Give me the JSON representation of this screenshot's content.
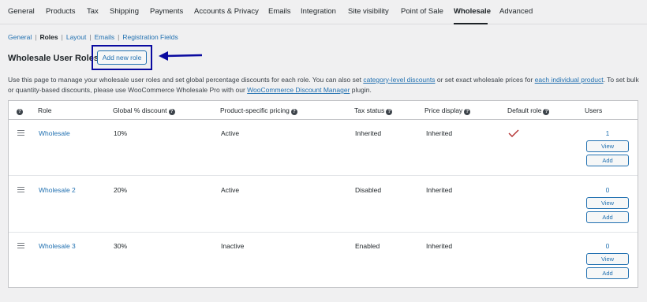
{
  "tabs": [
    {
      "label": "General"
    },
    {
      "label": "Products"
    },
    {
      "label": "Tax"
    },
    {
      "label": "Shipping"
    },
    {
      "label": "Payments"
    },
    {
      "label": "Accounts & Privacy"
    },
    {
      "label": "Emails"
    },
    {
      "label": "Integration"
    },
    {
      "label": "Site visibility"
    },
    {
      "label": "Point of Sale"
    },
    {
      "label": "Wholesale"
    },
    {
      "label": "Advanced"
    }
  ],
  "subnav": {
    "items": [
      "General",
      "Roles",
      "Layout",
      "Emails",
      "Registration Fields"
    ],
    "separator": "|"
  },
  "page": {
    "title": "Wholesale User Roles",
    "add_button": "Add new role"
  },
  "description": {
    "part1": "Use this page to manage your wholesale user roles and set global percentage discounts for each role. You can also set ",
    "link1": "category-level discounts",
    "part2": " or set exact wholesale prices for ",
    "link2": "each individual product",
    "part3": ". To set bulk or quantity-based discounts, please use WooCommerce Wholesale Pro with our ",
    "link3": "WooCommerce Discount Manager",
    "part4": " plugin."
  },
  "table": {
    "headers": {
      "role": "Role",
      "discount": "Global % discount",
      "pricing": "Product-specific pricing",
      "tax": "Tax status",
      "price_display": "Price display",
      "default_role": "Default role",
      "users": "Users"
    },
    "help_glyph": "?",
    "view_label": "View",
    "add_label": "Add",
    "rows": [
      {
        "role": "Wholesale",
        "discount": "10%",
        "pricing": "Active",
        "tax": "Inherited",
        "price_display": "Inherited",
        "default": true,
        "users": "1"
      },
      {
        "role": "Wholesale 2",
        "discount": "20%",
        "pricing": "Active",
        "tax": "Disabled",
        "price_display": "Inherited",
        "default": false,
        "users": "0"
      },
      {
        "role": "Wholesale 3",
        "discount": "30%",
        "pricing": "Inactive",
        "tax": "Enabled",
        "price_display": "Inherited",
        "default": false,
        "users": "0"
      }
    ]
  },
  "colors": {
    "link": "#2271b1",
    "annotation": "#0a0aa0",
    "check": "#b32d2e"
  },
  "icons": {
    "drag": "drag-handle-icon",
    "help": "help-icon",
    "default": "checkmark-icon",
    "arrow": "arrow-left-icon"
  }
}
